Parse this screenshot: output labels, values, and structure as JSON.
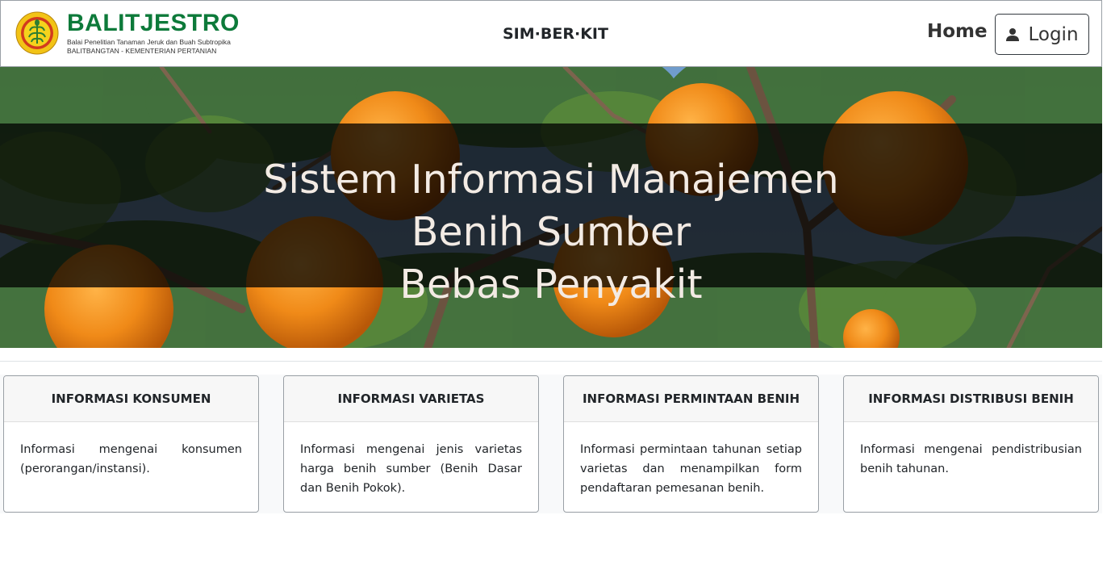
{
  "brand": {
    "name": "BALITJESTRO",
    "subtitle_line1": "Balai Penelitian Tanaman Jeruk dan Buah Subtropika",
    "subtitle_line2": "BALITBANGTAN - KEMENTERIAN PERTANIAN",
    "color": "#0d7a3a"
  },
  "nav": {
    "app_title": "SIM·BER·KIT",
    "home_label": "Home",
    "login_label": "Login",
    "login_icon": "user-icon"
  },
  "hero": {
    "line1": "Sistem Informasi Manajemen",
    "line2": "Benih Sumber",
    "line3": "Bebas Penyakit"
  },
  "cards": [
    {
      "title": "INFORMASI KONSUMEN",
      "body": "Informasi mengenai konsumen (perorangan/instansi)."
    },
    {
      "title": "INFORMASI VARIETAS",
      "body": "Informasi mengenai jenis varietas harga benih sumber (Benih Dasar dan Benih Pokok)."
    },
    {
      "title": "INFORMASI PERMINTAAN BENIH",
      "body": "Informasi permintaan tahunan setiap varietas dan menampilkan form pendaftaran pemesanan benih."
    },
    {
      "title": "INFORMASI DISTRIBUSI BENIH",
      "body": "Informasi mengenai pendistribusian benih tahunan."
    }
  ]
}
